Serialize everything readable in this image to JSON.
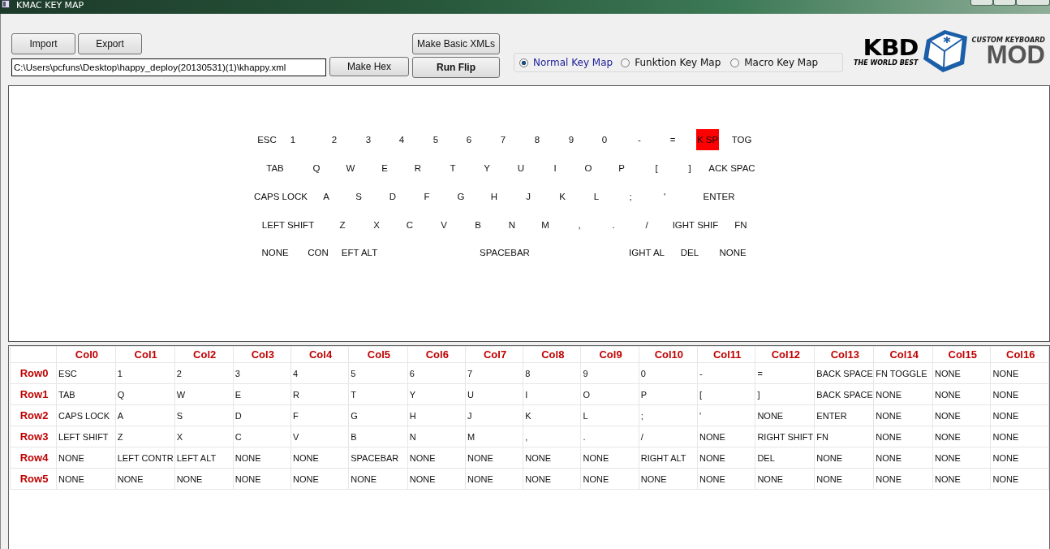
{
  "window": {
    "title": "KMAC KEY MAP"
  },
  "toolbar": {
    "import": "Import",
    "export": "Export",
    "path": "C:\\Users\\pcfuns\\Desktop\\happy_deploy(20130531)(1)\\khappy.xml",
    "make_hex": "Make Hex",
    "make_basic": "Make Basic XMLs",
    "run_flip": "Run Flip"
  },
  "map_modes": [
    {
      "label": "Normal Key Map",
      "selected": true
    },
    {
      "label": "Funktion Key Map",
      "selected": false
    },
    {
      "label": "Macro Key Map",
      "selected": false
    }
  ],
  "logo": {
    "brand": "KBD",
    "tagline": "THE WORLD BEST",
    "subtitle": "CUSTOM KEYBOARD",
    "name": "MOD"
  },
  "keyboard": [
    [
      {
        "label": "ESC",
        "selected": false
      },
      {
        "label": "1",
        "selected": false
      },
      {
        "label": "2",
        "selected": false
      },
      {
        "label": "3",
        "selected": false
      },
      {
        "label": "4",
        "selected": false
      },
      {
        "label": "5",
        "selected": false
      },
      {
        "label": "6",
        "selected": false
      },
      {
        "label": "7",
        "selected": false
      },
      {
        "label": "8",
        "selected": false
      },
      {
        "label": "9",
        "selected": false
      },
      {
        "label": "0",
        "selected": false
      },
      {
        "label": "-",
        "selected": false
      },
      {
        "label": "=",
        "selected": false
      },
      {
        "label": "K SP",
        "selected": true
      },
      {
        "label": "TOG",
        "selected": false
      }
    ],
    [
      {
        "label": "TAB",
        "selected": false
      },
      {
        "label": "Q",
        "selected": false
      },
      {
        "label": "W",
        "selected": false
      },
      {
        "label": "E",
        "selected": false
      },
      {
        "label": "R",
        "selected": false
      },
      {
        "label": "T",
        "selected": false
      },
      {
        "label": "Y",
        "selected": false
      },
      {
        "label": "U",
        "selected": false
      },
      {
        "label": "I",
        "selected": false
      },
      {
        "label": "O",
        "selected": false
      },
      {
        "label": "P",
        "selected": false
      },
      {
        "label": "[",
        "selected": false
      },
      {
        "label": "]",
        "selected": false
      },
      {
        "label": "ACK SPAC",
        "selected": false
      }
    ],
    [
      {
        "label": "CAPS LOCK",
        "selected": false
      },
      {
        "label": "A",
        "selected": false
      },
      {
        "label": "S",
        "selected": false
      },
      {
        "label": "D",
        "selected": false
      },
      {
        "label": "F",
        "selected": false
      },
      {
        "label": "G",
        "selected": false
      },
      {
        "label": "H",
        "selected": false
      },
      {
        "label": "J",
        "selected": false
      },
      {
        "label": "K",
        "selected": false
      },
      {
        "label": "L",
        "selected": false
      },
      {
        "label": ";",
        "selected": false
      },
      {
        "label": "'",
        "selected": false
      },
      {
        "label": "ENTER",
        "selected": false
      }
    ],
    [
      {
        "label": "LEFT SHIFT",
        "selected": false
      },
      {
        "label": "Z",
        "selected": false
      },
      {
        "label": "X",
        "selected": false
      },
      {
        "label": "C",
        "selected": false
      },
      {
        "label": "V",
        "selected": false
      },
      {
        "label": "B",
        "selected": false
      },
      {
        "label": "N",
        "selected": false
      },
      {
        "label": "M",
        "selected": false
      },
      {
        "label": ",",
        "selected": false
      },
      {
        "label": ".",
        "selected": false
      },
      {
        "label": "/",
        "selected": false
      },
      {
        "label": "IGHT SHIF",
        "selected": false
      },
      {
        "label": "FN",
        "selected": false
      }
    ],
    [
      {
        "label": "NONE",
        "selected": false
      },
      {
        "label": "CON",
        "selected": false
      },
      {
        "label": "EFT ALT",
        "selected": false
      },
      {
        "label": "SPACEBAR",
        "selected": false
      },
      {
        "label": "IGHT AL",
        "selected": false
      },
      {
        "label": "DEL",
        "selected": false
      },
      {
        "label": "NONE",
        "selected": false
      }
    ]
  ],
  "table": {
    "columns": [
      "Col0",
      "Col1",
      "Col2",
      "Col3",
      "Col4",
      "Col5",
      "Col6",
      "Col7",
      "Col8",
      "Col9",
      "Col10",
      "Col11",
      "Col12",
      "Col13",
      "Col14",
      "Col15",
      "Col16"
    ],
    "rows": [
      {
        "header": "Row0",
        "cells": [
          "ESC",
          "1",
          "2",
          "3",
          "4",
          "5",
          "6",
          "7",
          "8",
          "9",
          "0",
          "-",
          "=",
          "BACK SPACE",
          "FN TOGGLE",
          "NONE",
          "NONE"
        ]
      },
      {
        "header": "Row1",
        "cells": [
          "TAB",
          "Q",
          "W",
          "E",
          "R",
          "T",
          "Y",
          "U",
          "I",
          "O",
          "P",
          "[",
          "]",
          "BACK SPACE",
          "NONE",
          "NONE",
          "NONE"
        ]
      },
      {
        "header": "Row2",
        "cells": [
          "CAPS LOCK",
          "A",
          "S",
          "D",
          "F",
          "G",
          "H",
          "J",
          "K",
          "L",
          ";",
          "'",
          "NONE",
          "ENTER",
          "NONE",
          "NONE",
          "NONE"
        ]
      },
      {
        "header": "Row3",
        "cells": [
          "LEFT SHIFT",
          "Z",
          "X",
          "C",
          "V",
          "B",
          "N",
          "M",
          ",",
          ".",
          "/",
          "NONE",
          "RIGHT SHIFT",
          "FN",
          "NONE",
          "NONE",
          "NONE"
        ]
      },
      {
        "header": "Row4",
        "cells": [
          "NONE",
          "LEFT CONTR",
          "LEFT ALT",
          "NONE",
          "NONE",
          "SPACEBAR",
          "NONE",
          "NONE",
          "NONE",
          "NONE",
          "RIGHT ALT",
          "NONE",
          "DEL",
          "NONE",
          "NONE",
          "NONE",
          "NONE"
        ]
      },
      {
        "header": "Row5",
        "cells": [
          "NONE",
          "NONE",
          "NONE",
          "NONE",
          "NONE",
          "NONE",
          "NONE",
          "NONE",
          "NONE",
          "NONE",
          "NONE",
          "NONE",
          "NONE",
          "NONE",
          "NONE",
          "NONE",
          "NONE"
        ]
      }
    ]
  }
}
